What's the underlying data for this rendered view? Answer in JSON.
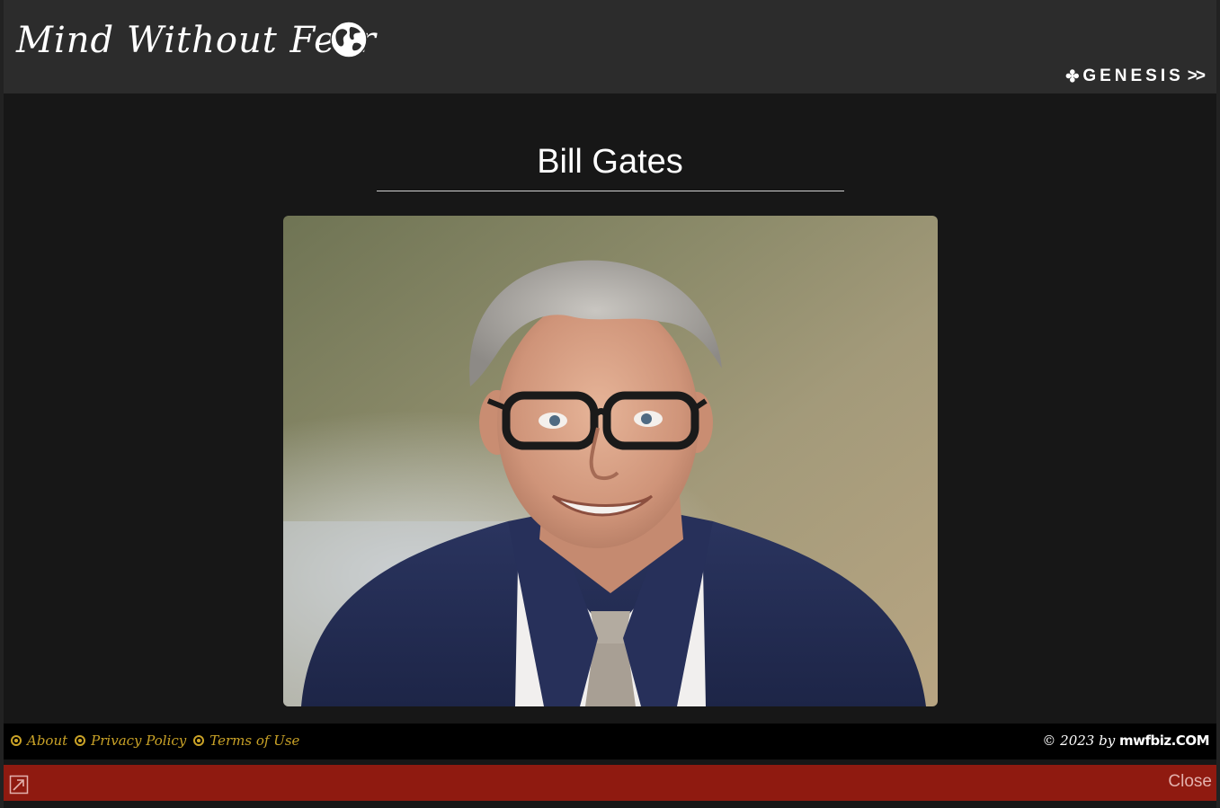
{
  "header": {
    "site_title": "Mind Without Fear",
    "genesis_label": "GENESIS",
    "genesis_prefix_icon": "clover-icon",
    "genesis_suffix": ">>",
    "logo_icon": "globe-icon"
  },
  "main": {
    "title": "Bill Gates",
    "image_alt": "Bill Gates portrait"
  },
  "footer": {
    "links": [
      {
        "label": "About"
      },
      {
        "label": "Privacy Policy"
      },
      {
        "label": "Terms of Use"
      }
    ],
    "copyright_prefix": "© 2023 by",
    "copyright_brand": "mwfbiz.COM"
  },
  "close_bar": {
    "close_label": "Close",
    "expand_icon": "expand-arrow-icon"
  },
  "colors": {
    "header_bg": "#2c2c2c",
    "page_bg": "#171717",
    "footer_link": "#c9a227",
    "close_bar_bg": "#8f1a10"
  }
}
